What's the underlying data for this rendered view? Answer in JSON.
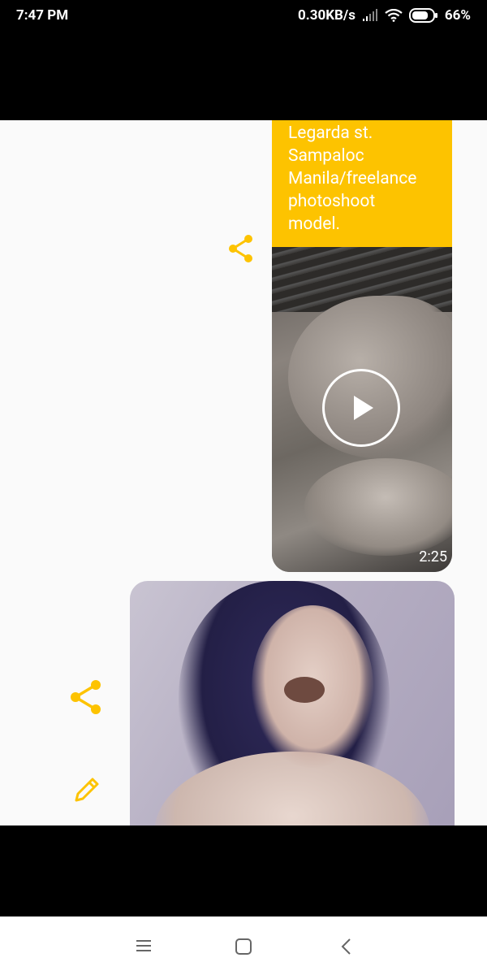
{
  "status_bar": {
    "time": "7:47 PM",
    "network_speed": "0.30KB/s",
    "battery": "66%"
  },
  "messages": [
    {
      "caption_lines": [
        "Legarda st.",
        "Sampaloc",
        "Manila/freelance",
        "photoshoot",
        "model."
      ],
      "video_duration": "2:25"
    },
    {
      "type": "photo"
    }
  ],
  "icons": {
    "share": "share-icon",
    "edit": "pencil-icon",
    "play": "play-icon"
  },
  "colors": {
    "accent": "#fdc300",
    "content_bg": "#fafafa"
  }
}
